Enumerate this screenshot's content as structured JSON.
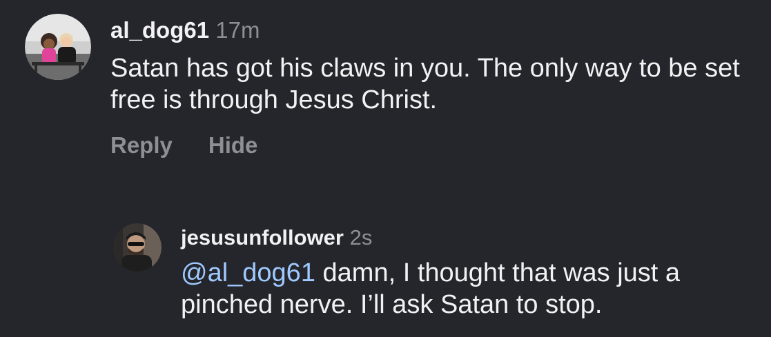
{
  "comments": [
    {
      "username": "al_dog61",
      "time": "17m",
      "text": "Satan has got his claws in you. The only way to be set free is through Jesus Christ.",
      "actions": {
        "reply": "Reply",
        "hide": "Hide"
      }
    },
    {
      "username": "jesusunfollower",
      "time": "2s",
      "mention": "@al_dog61",
      "text": "damn, I thought that was just a pinched nerve. I’ll ask Satan to stop."
    }
  ],
  "colors": {
    "background": "#25262b",
    "text": "#f2f2f4",
    "muted": "#8e8f95",
    "mention": "#9fc9ff"
  }
}
